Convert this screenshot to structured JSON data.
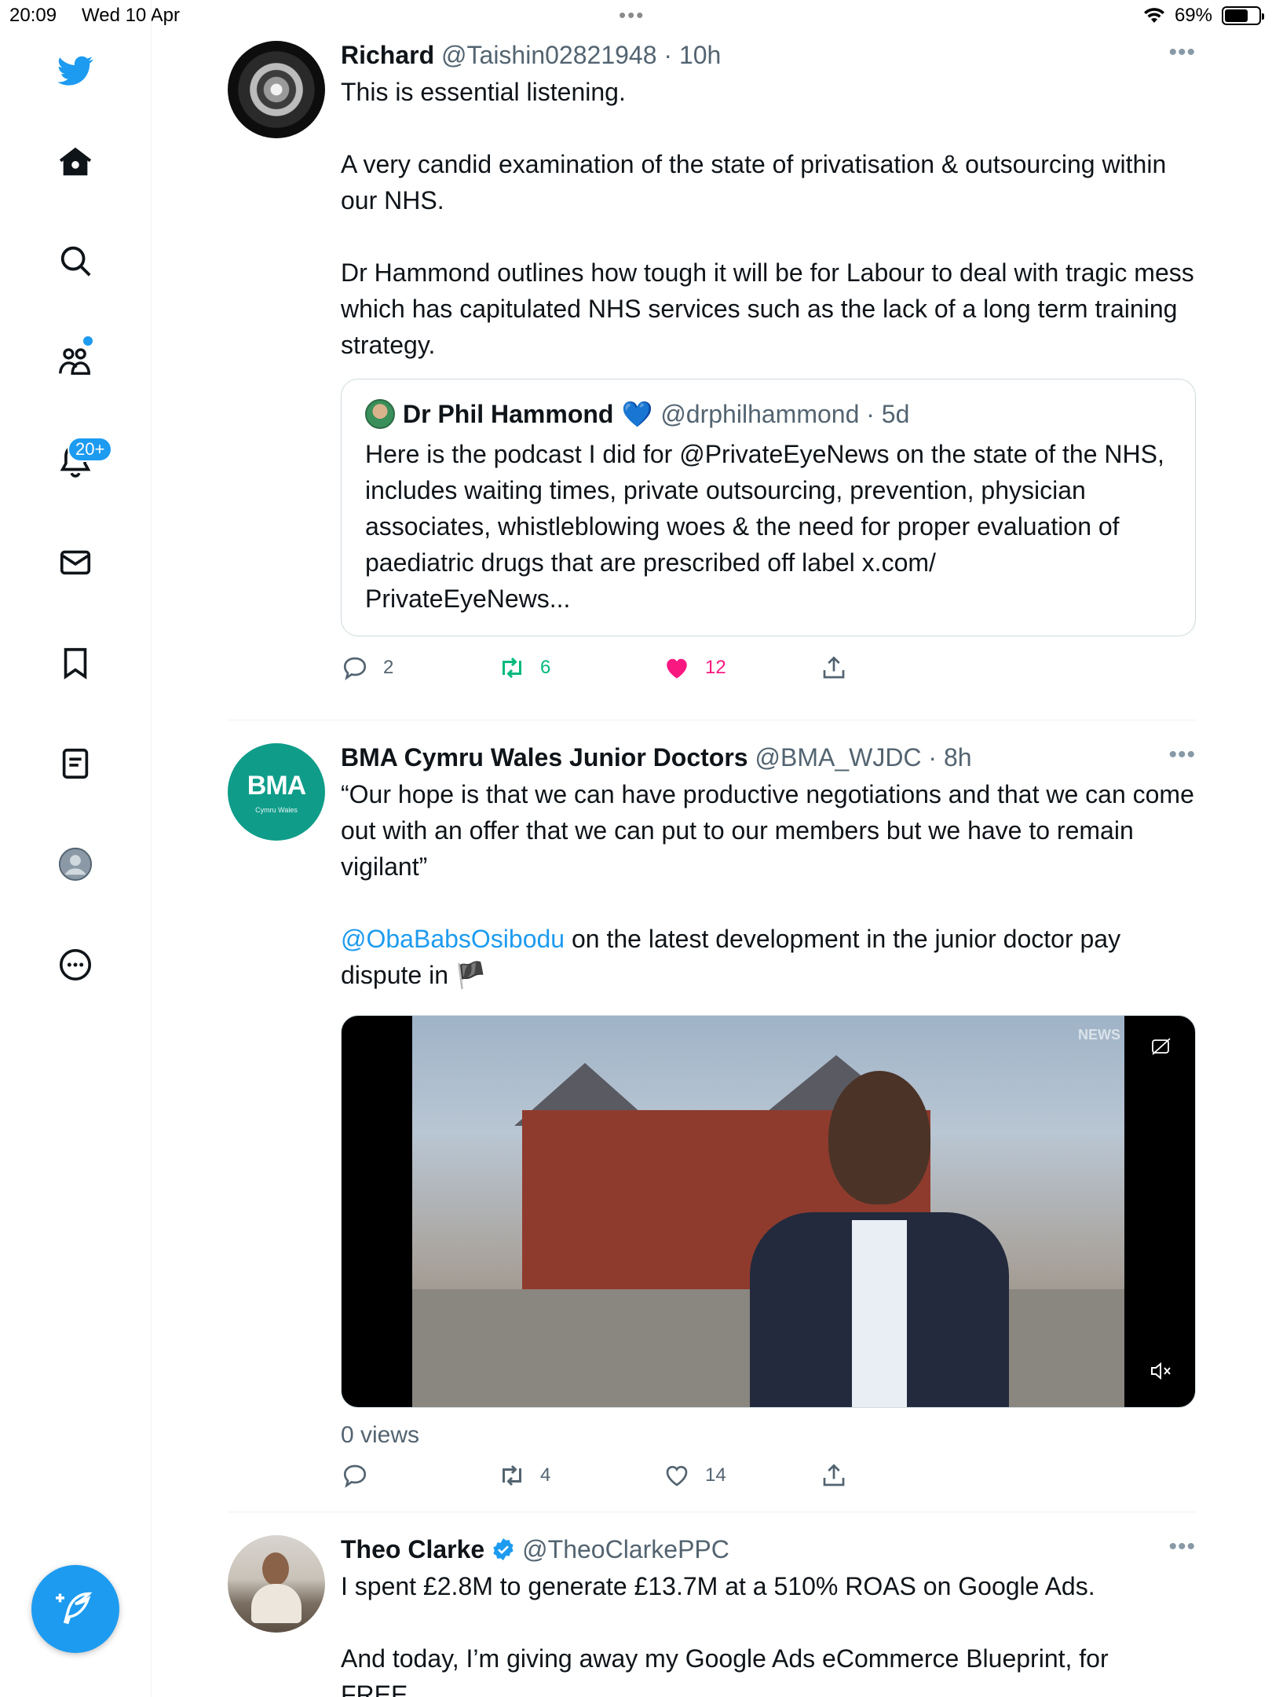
{
  "status_bar": {
    "time": "20:09",
    "date": "Wed 10 Apr",
    "battery": "69%",
    "battery_level": 0.69
  },
  "sidebar": {
    "notification_badge": "20+",
    "icons": [
      "twitter-logo",
      "home-icon",
      "search-icon",
      "communities-icon",
      "notifications-icon",
      "messages-icon",
      "bookmarks-icon",
      "lists-icon",
      "profile-icon",
      "more-icon"
    ]
  },
  "colors": {
    "accent": "#1d9bf0",
    "like_active": "#f91880",
    "retweet_active": "#00ba7c",
    "text_secondary": "#536471"
  },
  "tweets": [
    {
      "name": "Richard",
      "handle": "@Taishin02821948 · 10h",
      "text": "This is essential listening.\n\nA very candid examination of the state of privatisation & outsourcing within our NHS.\n\nDr Hammond outlines how tough it will be for Labour to deal with tragic mess which has capitulated NHS services such as the lack of a long term training strategy.",
      "quote": {
        "name": "Dr Phil Hammond",
        "emoji": "💙",
        "handle": "@drphilhammond · 5d",
        "text": "Here is the podcast I did for @PrivateEyeNews on the state of the NHS, includes waiting times, private outsourcing, prevention, physician associates, whistleblowing woes & the need for proper evaluation of paediatric drugs that are prescribed off label x.com/\nPrivateEyeNews..."
      },
      "replies": "2",
      "retweets": "6",
      "likes": "12"
    },
    {
      "name": "BMA Cymru Wales Junior Doctors",
      "handle": "@BMA_WJDC · 8h",
      "avatar_text": "BMA",
      "avatar_subtext": "Cymru Wales",
      "text": "“Our hope is that we can have productive negotiations and that we can come out with an offer that we can put to our members but we have to remain vigilant”",
      "mention": "@ObaBabsOsibodu",
      "text2": " on the latest development in the junior doctor pay dispute in 🏴",
      "video_watermark": "NEWS",
      "views": "0 views",
      "replies": "",
      "retweets": "4",
      "likes": "14"
    },
    {
      "name": "Theo Clarke",
      "handle": "@TheoClarkePPC",
      "text": "I spent £2.8M to generate £13.7M at a 510% ROAS on Google Ads.\n\nAnd today, I’m giving away my Google Ads eCommerce Blueprint, for\nFREE."
    }
  ]
}
